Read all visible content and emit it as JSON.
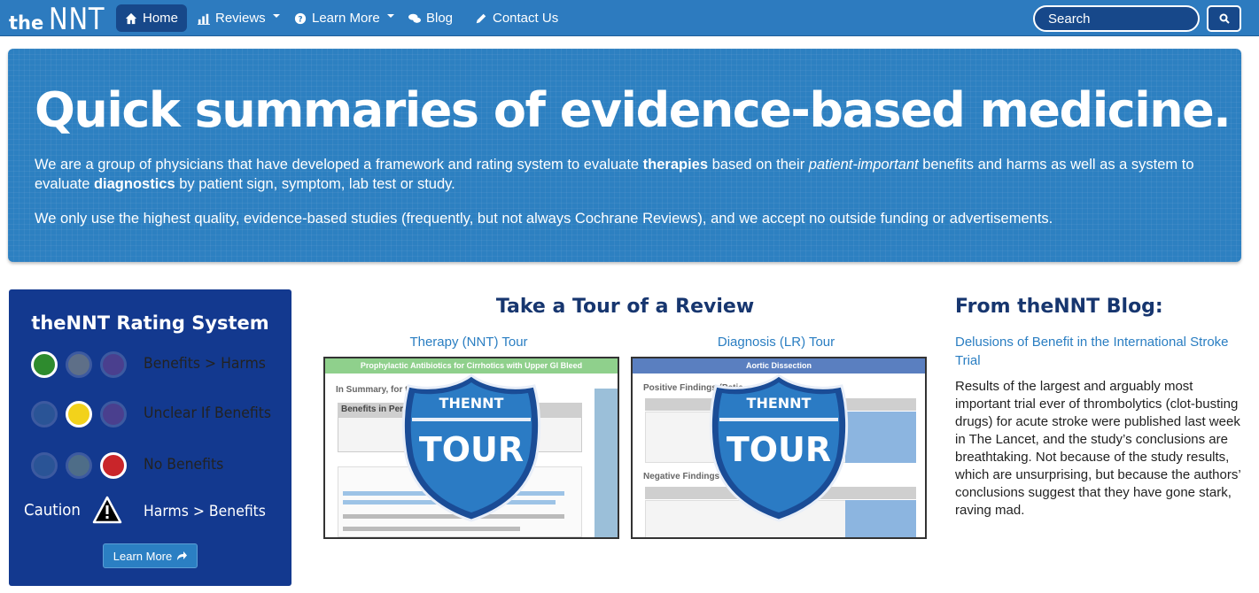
{
  "brand": {
    "prefix": "the",
    "name": "NNT"
  },
  "nav": {
    "home": "Home",
    "reviews": "Reviews",
    "learn_more": "Learn More",
    "blog": "Blog",
    "contact": "Contact Us"
  },
  "search": {
    "placeholder": "Search"
  },
  "hero": {
    "title": "Quick summaries of evidence-based medicine.",
    "p1_a": "We are a group of physicians that have developed a framework and rating system to evaluate ",
    "p1_b": "therapies",
    "p1_c": " based on their ",
    "p1_d": "patient-important",
    "p1_e": " benefits and harms as well as a system to evaluate ",
    "p1_f": "diagnostics",
    "p1_g": " by patient sign, symptom, lab test or study.",
    "p2": "We only use the highest quality, evidence-based studies (frequently, but not always Cochrane Reviews), and we accept no outside funding or advertisements."
  },
  "rating": {
    "title": "theNNT Rating System",
    "rows": [
      {
        "label": "Benefits > Harms"
      },
      {
        "label": "Unclear If Benefits"
      },
      {
        "label": "No Benefits"
      },
      {
        "label": "Harms > Benefits"
      }
    ],
    "caution": "Caution",
    "learn_more": "Learn More",
    "colors": {
      "green": "#2e8b2e",
      "yellow": "#f2d21b",
      "red": "#c9252a",
      "dim_blue": "#2a5496",
      "dim_gray": "#5e6f88",
      "dim_purple": "#4a3f8e",
      "dim_teal": "#4e6d88"
    }
  },
  "tour": {
    "title": "Take a Tour of a Review",
    "therapy_link": "Therapy (NNT) Tour",
    "diagnosis_link": "Diagnosis (LR) Tour",
    "therapy_bar": "Prophylactic Antibiotics for Cirrhotics with Upper GI Bleed",
    "diagnosis_bar": "Aortic Dissection",
    "therapy_sub1": "In Summary, for thos",
    "therapy_sub2": "Benefits in Perce",
    "diagnosis_sub1": "Positive Findings (Patie",
    "diagnosis_sub2": "Negative Findings (Patie",
    "badge_top": "THENNT",
    "badge_word": "TOUR"
  },
  "blog": {
    "title": "From theNNT Blog:",
    "link": "Delusions of Benefit in the International Stroke Trial",
    "text": "Results of the largest and arguably most important trial ever of thrombolytics (clot-busting drugs) for acute stroke were published last week in The Lancet, and the study’s conclusions are breathtaking. Not because of the study results, which are unsurprising, but because the authors’ conclusions suggest that they have gone stark, raving mad."
  }
}
